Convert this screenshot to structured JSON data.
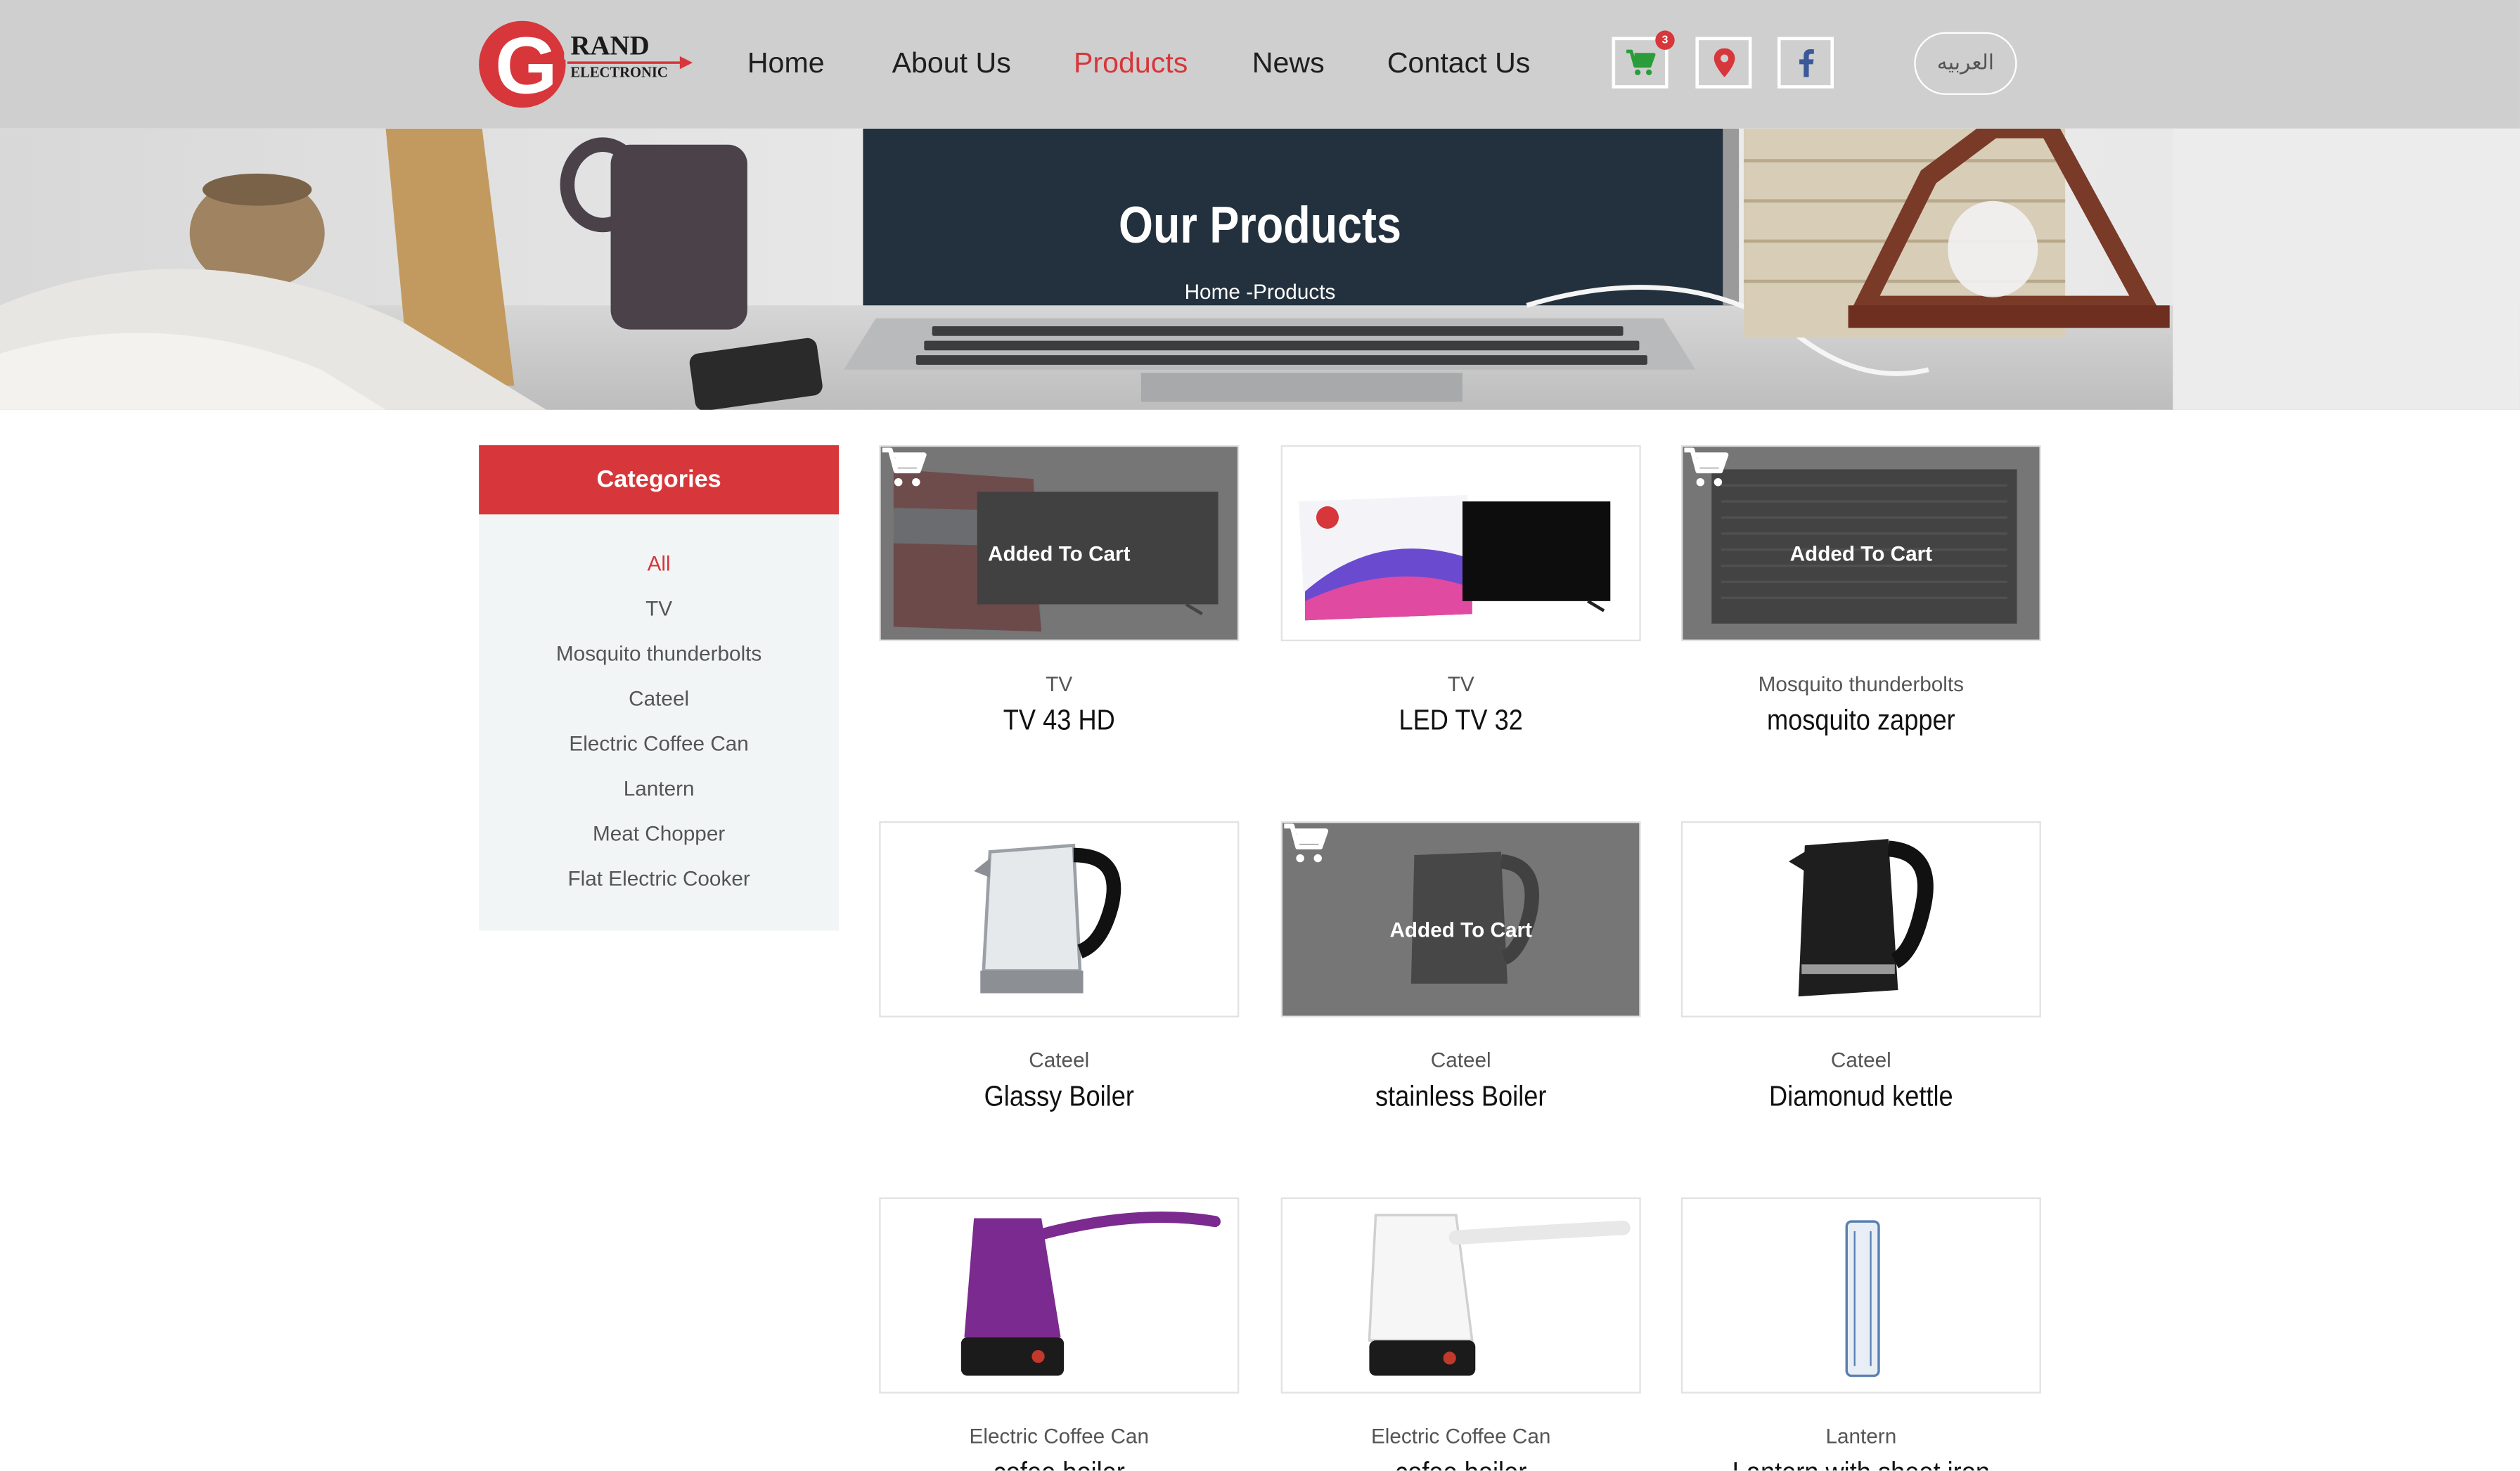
{
  "header": {
    "logo": {
      "text_big": "RAND",
      "text_small": "ELECTRONIC",
      "letter": "G"
    },
    "nav": [
      {
        "label": "Home",
        "active": false
      },
      {
        "label": "About Us",
        "active": false
      },
      {
        "label": "Products",
        "active": true
      },
      {
        "label": "News",
        "active": false
      },
      {
        "label": "Contact Us",
        "active": false
      }
    ],
    "cart_count": "3",
    "icons": [
      "cart-icon",
      "location-pin-icon",
      "facebook-icon"
    ],
    "language_label": "العربيه"
  },
  "banner": {
    "title": "Our Products",
    "breadcrumb_home": "Home",
    "breadcrumb_sep": " -",
    "breadcrumb_current": "Products"
  },
  "sidebar": {
    "heading": "Categories",
    "items": [
      {
        "label": "All",
        "active": true
      },
      {
        "label": "TV",
        "active": false
      },
      {
        "label": "Mosquito thunderbolts",
        "active": false
      },
      {
        "label": "Cateel",
        "active": false
      },
      {
        "label": "Electric Coffee Can",
        "active": false
      },
      {
        "label": "Lantern",
        "active": false
      },
      {
        "label": "Meat Chopper",
        "active": false
      },
      {
        "label": "Flat Electric Cooker",
        "active": false
      }
    ]
  },
  "added_label": "Added To Cart",
  "products": [
    {
      "category": "TV",
      "name": "TV 43 HD",
      "added": true
    },
    {
      "category": "TV",
      "name": "LED TV 32",
      "added": false
    },
    {
      "category": "Mosquito thunderbolts",
      "name": "mosquito zapper",
      "added": true
    },
    {
      "category": "Cateel",
      "name": "Glassy Boiler",
      "added": false
    },
    {
      "category": "Cateel",
      "name": "stainless Boiler",
      "added": true
    },
    {
      "category": "Cateel",
      "name": "Diamonud kettle",
      "added": false
    },
    {
      "category": "Electric Coffee Can",
      "name": "cofee boiler",
      "added": false
    },
    {
      "category": "Electric Coffee Can",
      "name": "cofee boiler",
      "added": false
    },
    {
      "category": "Lantern",
      "name": "Lantern with sheet iron",
      "added": false
    }
  ],
  "colors": {
    "accent": "#d7363b",
    "header_bg": "#cfcfcf",
    "sidebar_bg": "#f1f5f5"
  }
}
